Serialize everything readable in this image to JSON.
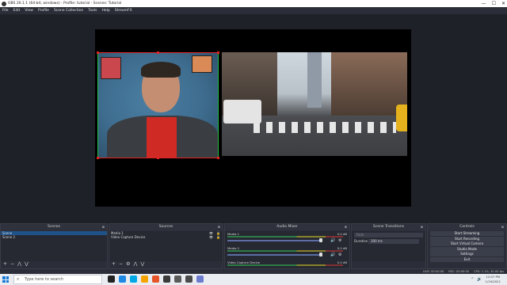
{
  "window": {
    "title": "OBS 26.1.1 (64-bit, windows) - Profile: tutorial - Scenes: Tutorial"
  },
  "window_buttons": {
    "minimize": "—",
    "maximize": "☐",
    "close": "✕"
  },
  "menu": [
    "File",
    "Edit",
    "View",
    "Profile",
    "Scene Collection",
    "Tools",
    "Help",
    "StreamFX"
  ],
  "docks": {
    "scenes": {
      "title": "Scenes",
      "items": [
        "Scene",
        "Scene 2"
      ],
      "selected_index": 0,
      "pin": "⊞"
    },
    "sources": {
      "title": "Sources",
      "items": [
        "Media 1",
        "Video Capture Device"
      ],
      "visibility_icon": "👁",
      "lock_icon": "🔒",
      "pin": "⊞"
    },
    "audio_mixer": {
      "title": "Audio Mixer",
      "pin": "⊞",
      "channels": [
        {
          "name": "Media 1",
          "db": "0.0 dB"
        },
        {
          "name": "Media 2",
          "db": "0.0 dB"
        },
        {
          "name": "Video Capture Device",
          "db": "0.0 dB"
        }
      ]
    },
    "transitions": {
      "title": "Scene Transitions",
      "fade": "Fade",
      "duration_label": "Duration",
      "duration_value": "300 ms",
      "pin": "⊞"
    },
    "controls": {
      "title": "Controls",
      "pin": "⊞",
      "buttons": [
        "Start Streaming",
        "Start Recording",
        "Start Virtual Camera",
        "Studio Mode",
        "Settings",
        "Exit"
      ]
    }
  },
  "footer_icons": {
    "add": "+",
    "remove": "−",
    "settings": "⚙",
    "up": "⋀",
    "down": "⋁"
  },
  "statusbar": {
    "live": "LIVE: 00:00:00",
    "rec": "REC: 00:00:00",
    "cpu": "CPU: 1.1%, 30.00 fps"
  },
  "taskbar": {
    "search_placeholder": "Type here to search",
    "time": "12:07 PM",
    "date": "1/19/2021",
    "app_colors": [
      "#222222",
      "#1e88e5",
      "#00a8e8",
      "#f4a300",
      "#e8542a",
      "#3a3a3a",
      "#5a5a5a",
      "#4a4a4a",
      "#6b7ccf"
    ]
  }
}
